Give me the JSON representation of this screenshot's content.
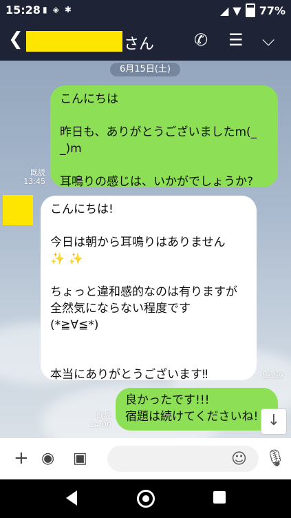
{
  "status_bar": {
    "time": "15:28",
    "icons": [
      "battery-saver-icon",
      "data-0-icon",
      "notification-icon"
    ],
    "battery": "77%"
  },
  "header": {
    "contact_suffix": "さん",
    "icons": [
      "back-icon",
      "phone-icon",
      "notes-icon",
      "menu-chevron-icon"
    ]
  },
  "chat": {
    "date": "6月15日(土)",
    "messages": [
      {
        "side": "right",
        "text": "こんにちは\n\n昨日も、ありがとうございましたm(_\n_)m\n\n耳鳴りの感じは、いかがでしょうか?",
        "read_label": "既読",
        "time": "13:45"
      },
      {
        "side": "left",
        "text": "こんにちは!\n\n今日は朝から耳鳴りはありません\n✨ ✨\n\nちょっと違和感的なのは有りますが\n全然気にならない程度です\n(*≧∀≦*)\n\n\n本当にありがとうございます‼",
        "time": "13:59"
      },
      {
        "side": "right",
        "text": "良かったです!!!\n宿題は続けてくださいね!",
        "read_label": "既読",
        "time": "14:00"
      }
    ]
  },
  "input": {
    "placeholder": ""
  },
  "colors": {
    "header_bg": "#1e2436",
    "bubble_green": "#8de055",
    "bubble_white": "#ffffff",
    "redaction_yellow": "#ffe600"
  }
}
